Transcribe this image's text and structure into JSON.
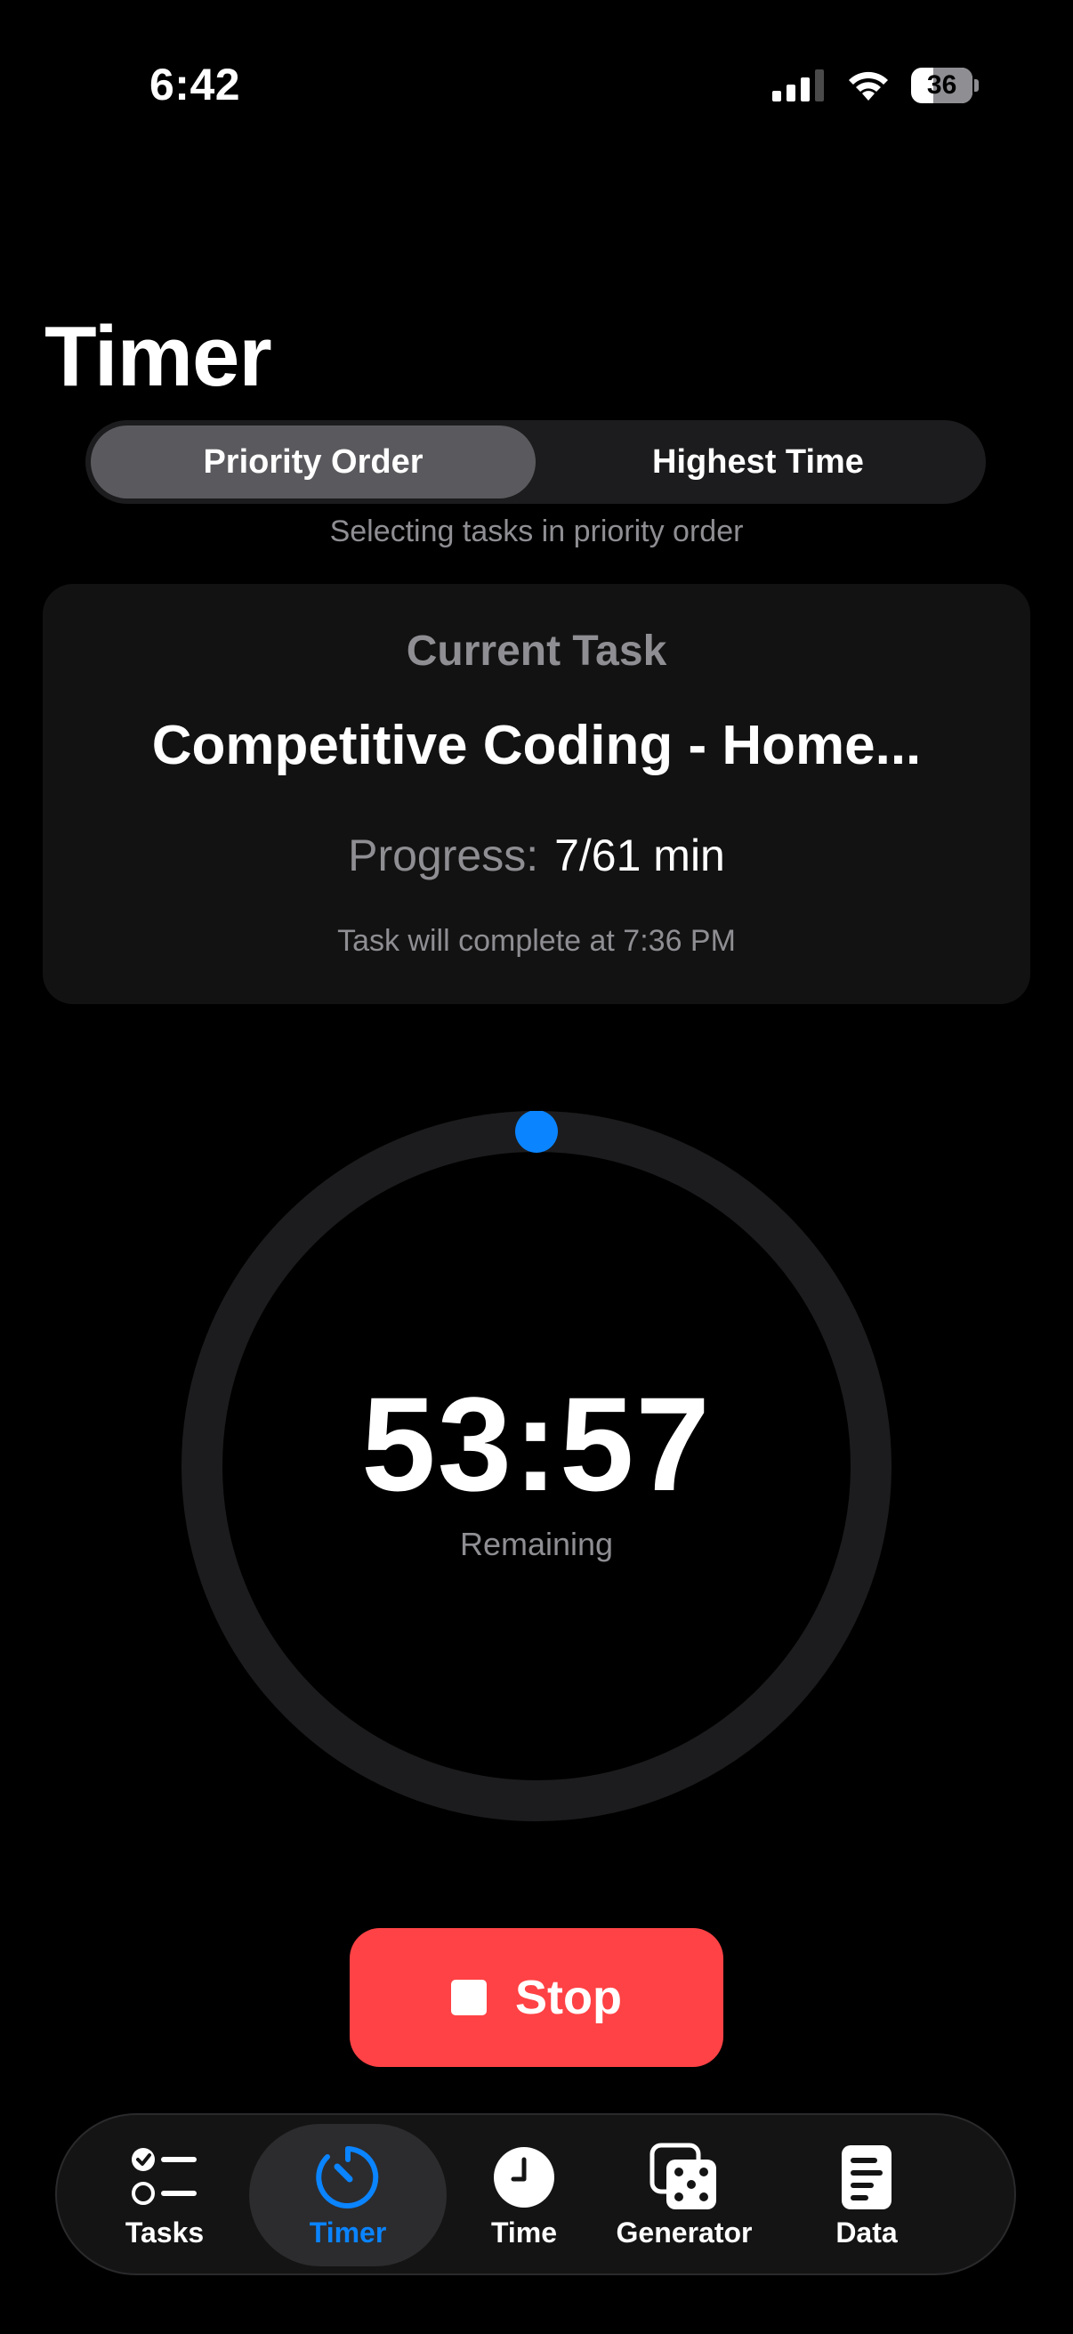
{
  "status_bar": {
    "time": "6:42",
    "battery_level": "36",
    "battery_fraction": 0.36
  },
  "page": {
    "title": "Timer"
  },
  "mode_selector": {
    "options": [
      "Priority Order",
      "Highest Time"
    ],
    "selected": "Priority Order",
    "hint": "Selecting tasks in priority order"
  },
  "current_task": {
    "heading": "Current Task",
    "name": "Competitive Coding - Home...",
    "progress_label": "Progress:",
    "progress_value": "7/61 min",
    "completion_text": "Task will complete at 7:36 PM"
  },
  "timer": {
    "remaining_time": "53:57",
    "remaining_label": "Remaining",
    "progress_fraction": 0.0,
    "ring_track_color": "#1c1c1e",
    "indicator_color": "#0a84ff"
  },
  "actions": {
    "stop_label": "Stop",
    "stop_color": "#ff4245"
  },
  "tab_bar": {
    "items": [
      {
        "label": "Tasks",
        "icon": "checklist-icon"
      },
      {
        "label": "Timer",
        "icon": "timer-icon"
      },
      {
        "label": "Time",
        "icon": "clock-icon"
      },
      {
        "label": "Generator",
        "icon": "dice-icon"
      },
      {
        "label": "Data",
        "icon": "document-icon"
      }
    ],
    "active": "Timer",
    "active_color": "#0a84ff"
  }
}
